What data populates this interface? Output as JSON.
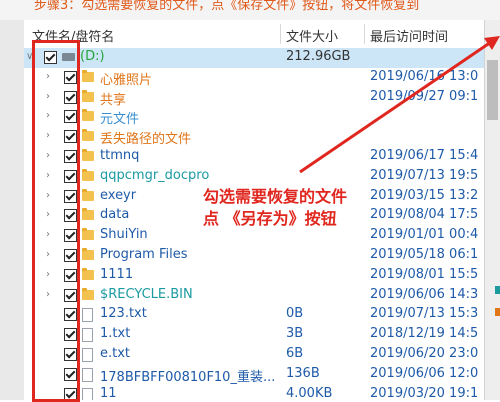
{
  "top_banner": "步骤3：勾选需要恢复的文件，点《保存文件》按钮，将文件恢复到",
  "header": {
    "name_col": "文件名/盘符名",
    "size_col": "文件大小",
    "date_col": "最后访问时间"
  },
  "rows": [
    {
      "name": "(D:)",
      "size": "212.96GB",
      "date": "",
      "kind": "drive",
      "color": "green"
    },
    {
      "name": "心雅照片",
      "size": "",
      "date": "2019/06/16 13:0",
      "kind": "folder",
      "color": "orange"
    },
    {
      "name": "共享",
      "size": "",
      "date": "2019/09/27 09:1",
      "kind": "folder",
      "color": "orange"
    },
    {
      "name": "元文件",
      "size": "",
      "date": "",
      "kind": "folder",
      "color": "lightblue"
    },
    {
      "name": "丢失路径的文件",
      "size": "",
      "date": "",
      "kind": "folder",
      "color": "orange"
    },
    {
      "name": "ttmnq",
      "size": "",
      "date": "2019/06/17 15:4",
      "kind": "folder",
      "color": "blue"
    },
    {
      "name": "qqpcmgr_docpro",
      "size": "",
      "date": "2019/07/13 19:5",
      "kind": "folder",
      "color": "teal"
    },
    {
      "name": "exeyr",
      "size": "",
      "date": "2019/03/15 13:2",
      "kind": "folder",
      "color": "blue"
    },
    {
      "name": "data",
      "size": "",
      "date": "2019/08/04 17:5",
      "kind": "folder",
      "color": "blue"
    },
    {
      "name": "ShuiYin",
      "size": "",
      "date": "2019/01/01 00:4",
      "kind": "folder",
      "color": "blue"
    },
    {
      "name": "Program Files",
      "size": "",
      "date": "2019/05/18 06:1",
      "kind": "folder",
      "color": "blue"
    },
    {
      "name": "1111",
      "size": "",
      "date": "2019/08/01 15:5",
      "kind": "folder",
      "color": "blue"
    },
    {
      "name": "$RECYCLE.BIN",
      "size": "",
      "date": "2019/06/06 14:3",
      "kind": "folder",
      "color": "teal"
    },
    {
      "name": "123.txt",
      "size": "0B",
      "date": "2019/07/13 15:3",
      "kind": "file",
      "color": "blue"
    },
    {
      "name": "1.txt",
      "size": "3B",
      "date": "2018/12/19 14:5",
      "kind": "file",
      "color": "blue"
    },
    {
      "name": "e.txt",
      "size": "6B",
      "date": "2019/06/20 23:0",
      "kind": "file",
      "color": "blue"
    },
    {
      "name": "178BFBFF00810F10_重装...",
      "size": "136B",
      "date": "2019/06/06 12:0",
      "kind": "file",
      "color": "blue"
    },
    {
      "name": "11",
      "size": "4.00KB",
      "date": "2019/03/20 19:1",
      "kind": "file",
      "color": "blue"
    }
  ],
  "annotation": {
    "line1": "勾选需要恢复的文件",
    "line2": "点 《另存为》按钮"
  },
  "colors": {
    "highlight": "#e0271f",
    "drive_row_bg": "#cde6f7",
    "link_blue": "#1e5aa8"
  }
}
